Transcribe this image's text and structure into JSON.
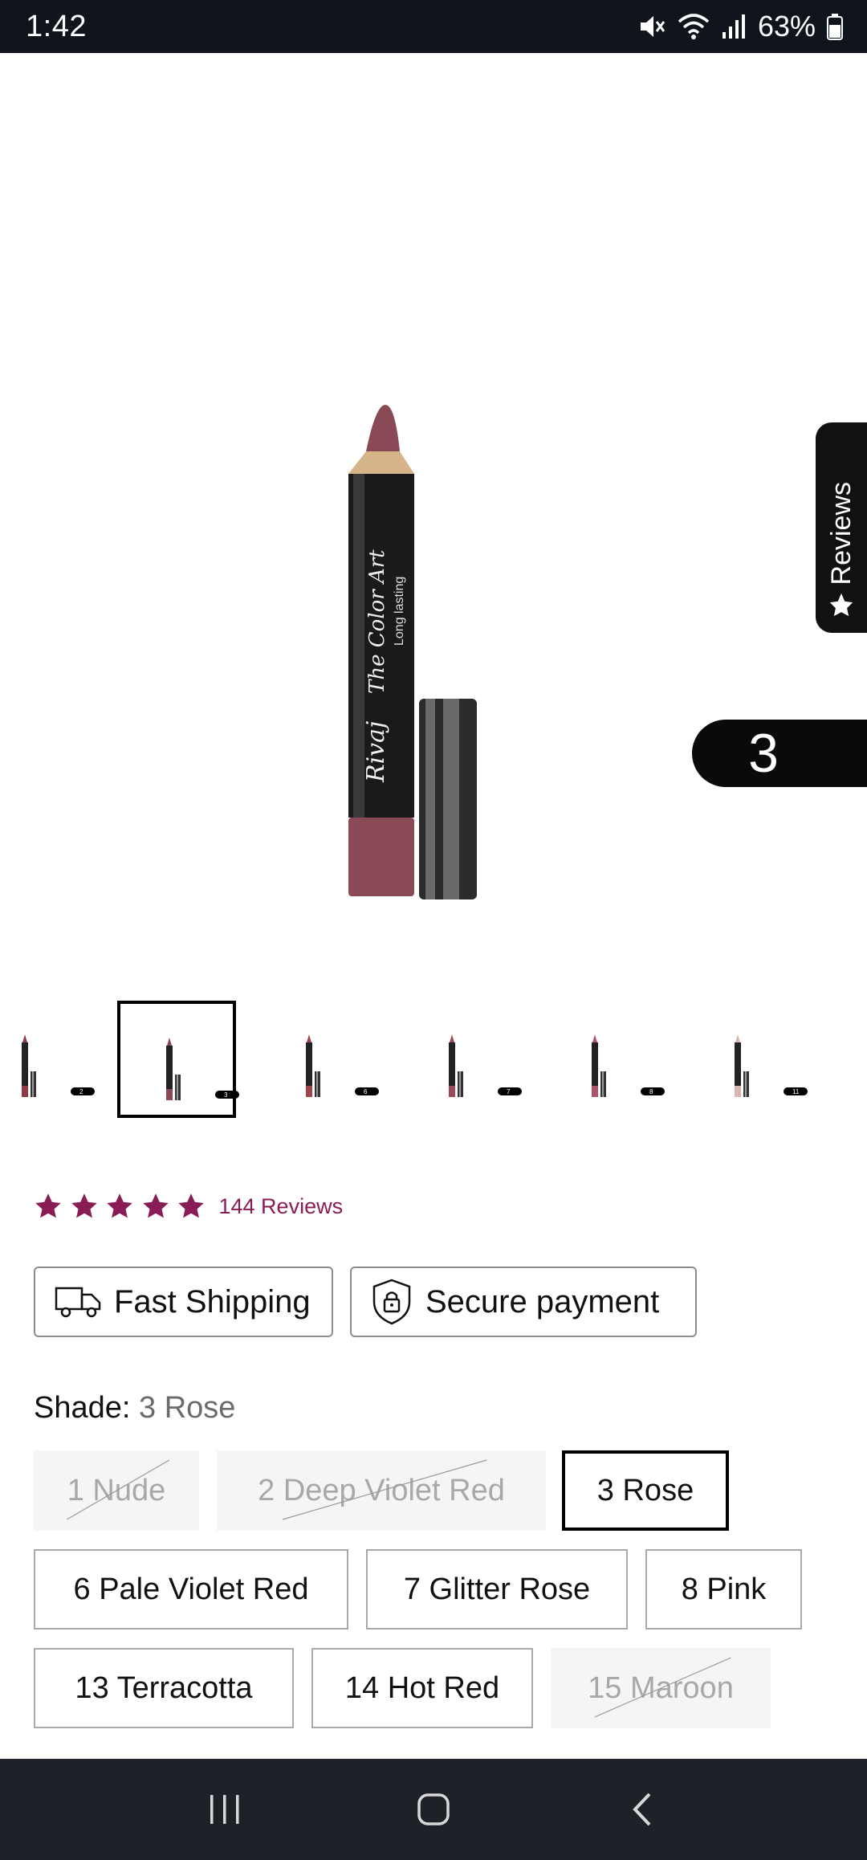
{
  "status_bar": {
    "time": "1:42",
    "battery": "63%"
  },
  "reviews_tab": {
    "label": "Reviews"
  },
  "shade_badge": {
    "number": "3"
  },
  "product": {
    "brand": "Rivaj",
    "line": "The Color Art",
    "tagline": "Long lasting"
  },
  "thumbnails": [
    {
      "number": "2",
      "color": "#8f3a46"
    },
    {
      "number": "3",
      "color": "#8a4a55"
    },
    {
      "number": "6",
      "color": "#a0454e"
    },
    {
      "number": "7",
      "color": "#9a4b57"
    },
    {
      "number": "8",
      "color": "#b0526a"
    },
    {
      "number": "11",
      "color": "#d7b8b0"
    }
  ],
  "rating": {
    "stars": 5,
    "count_label": "144 Reviews",
    "star_color": "#8a1c55"
  },
  "features": {
    "shipping": "Fast Shipping",
    "payment": "Secure payment"
  },
  "shade": {
    "label": "Shade:",
    "selected": "3 Rose"
  },
  "shade_options": [
    {
      "label": "1 Nude",
      "state": "unavailable"
    },
    {
      "label": "2 Deep Violet Red",
      "state": "unavailable"
    },
    {
      "label": "3 Rose",
      "state": "selected"
    },
    {
      "label": "6 Pale Violet Red",
      "state": "available"
    },
    {
      "label": "7 Glitter Rose",
      "state": "available"
    },
    {
      "label": "8 Pink",
      "state": "available"
    },
    {
      "label": "13 Terracotta",
      "state": "available"
    },
    {
      "label": "14 Hot Red",
      "state": "available"
    },
    {
      "label": "15 Maroon",
      "state": "unavailable"
    }
  ],
  "colors": {
    "accent": "#8a1c55",
    "lipstick": "#8a4a55",
    "status_bar": "#10141c",
    "nav_bar": "#1e2128"
  }
}
